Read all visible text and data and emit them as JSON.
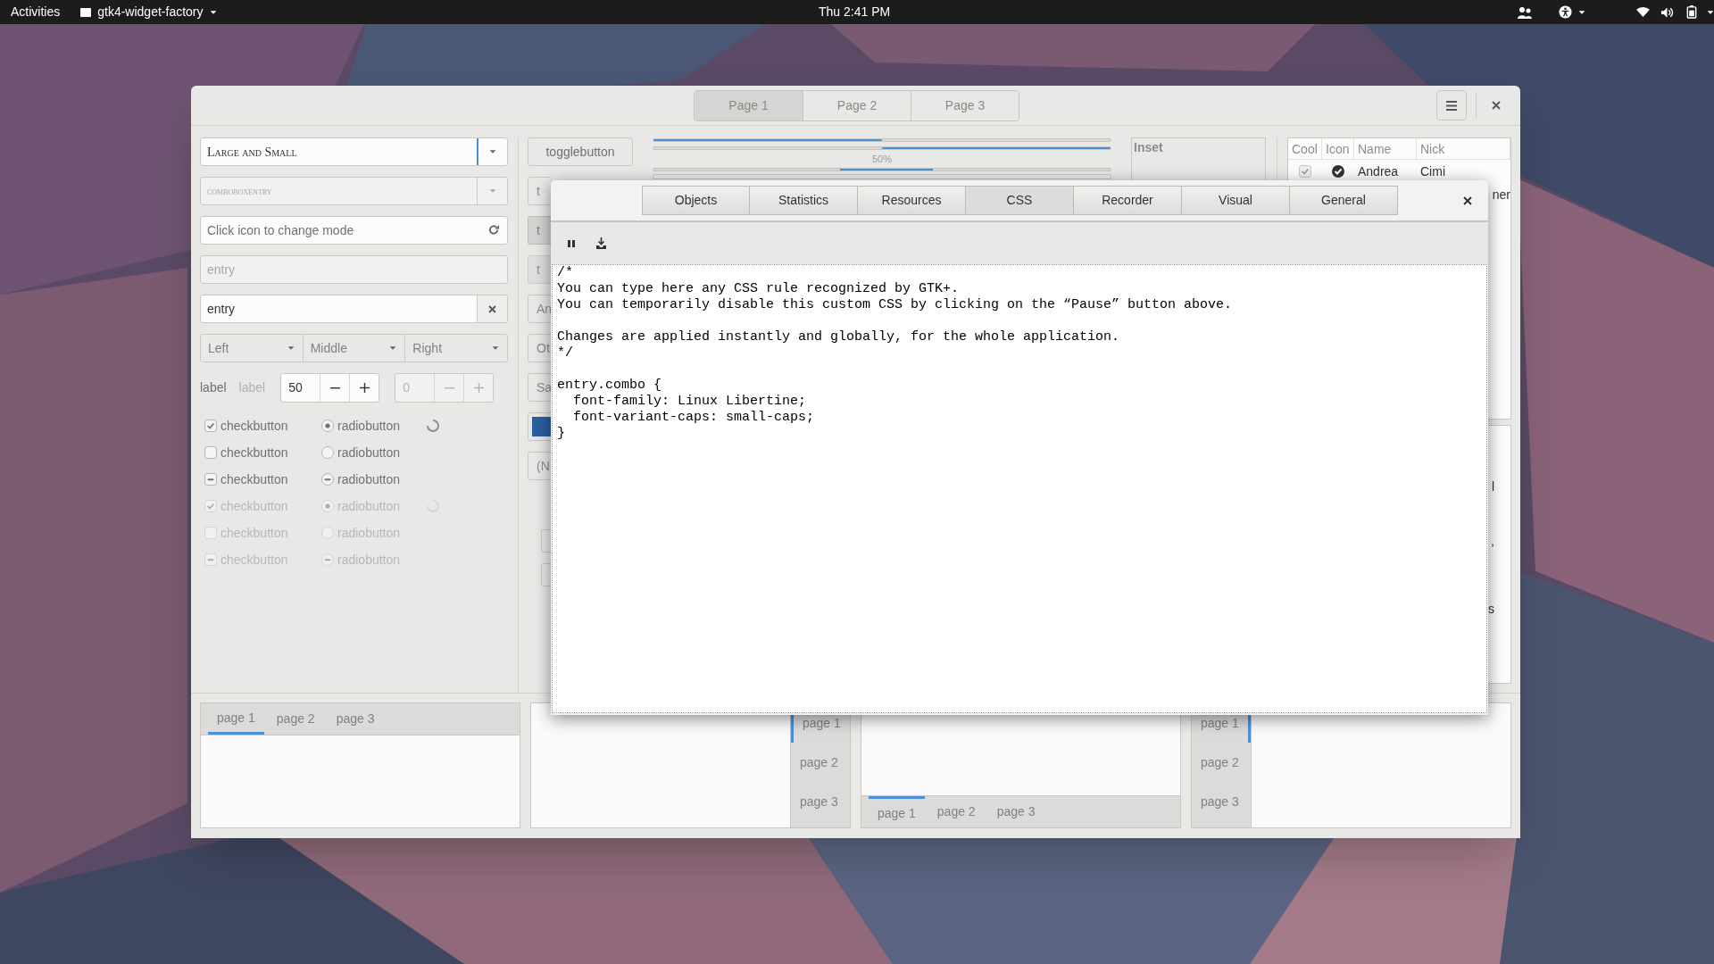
{
  "top_bar": {
    "activities": "Activities",
    "app_menu": "gtk4-widget-factory",
    "clock": "Thu  2:41 PM"
  },
  "main_window": {
    "stack_switcher": [
      {
        "label": "Page 1",
        "selected": true
      },
      {
        "label": "Page 2",
        "selected": false
      },
      {
        "label": "Page 3",
        "selected": false
      }
    ],
    "combo": {
      "value": "Large and Small"
    },
    "combo_entry": {
      "value": "comboboxentry",
      "disabled": true
    },
    "mode_entry": {
      "placeholder": "Click icon to change mode"
    },
    "disabled_entry": {
      "value": "entry",
      "disabled": true
    },
    "clear_entry": {
      "value": "entry"
    },
    "linked_combos": [
      {
        "label": "Left"
      },
      {
        "label": "Middle"
      },
      {
        "label": "Right"
      }
    ],
    "labels": [
      {
        "text": "label",
        "disabled": false
      },
      {
        "text": "label",
        "disabled": true
      }
    ],
    "spin_buttons": [
      {
        "value": "50",
        "disabled": false
      },
      {
        "value": "0",
        "disabled": true
      }
    ],
    "check_rows": [
      {
        "kind": "checked",
        "check_label": "checkbutton",
        "radio_label": "radiobutton",
        "spinner": true,
        "disabled": false
      },
      {
        "kind": "unchecked",
        "check_label": "checkbutton",
        "radio_label": "radiobutton",
        "spinner": false,
        "disabled": false
      },
      {
        "kind": "mixed",
        "check_label": "checkbutton",
        "radio_label": "radiobutton",
        "spinner": false,
        "disabled": false
      },
      {
        "kind": "checked",
        "check_label": "checkbutton",
        "radio_label": "radiobutton",
        "spinner": true,
        "disabled": true
      },
      {
        "kind": "unchecked",
        "check_label": "checkbutton",
        "radio_label": "radiobutton",
        "spinner": false,
        "disabled": true
      },
      {
        "kind": "mixed",
        "check_label": "checkbutton",
        "radio_label": "radiobutton",
        "spinner": false,
        "disabled": true
      }
    ],
    "buttons": [
      {
        "kind": "normal",
        "label": "togglebutton"
      },
      {
        "kind": "stub",
        "label": "t"
      },
      {
        "kind": "pressed",
        "label": "t"
      },
      {
        "kind": "pressed-disabled",
        "label": "t"
      },
      {
        "kind": "stub",
        "label": "An"
      },
      {
        "kind": "stub",
        "label": "Ot"
      },
      {
        "kind": "stub",
        "label": "Sa"
      },
      {
        "kind": "color",
        "color": "#2a5f9e"
      },
      {
        "kind": "stub",
        "label": "(N"
      },
      {
        "kind": "blank"
      },
      {
        "kind": "blank"
      }
    ],
    "progress": {
      "bars": [
        {
          "kind": "normal",
          "level": 0.5
        },
        {
          "kind": "inverted",
          "level": 0.5
        }
      ],
      "label": "50%"
    },
    "inset_frame": {
      "label": "Inset"
    },
    "tree": {
      "columns": [
        "Cool",
        "Icon",
        "Name",
        "Nick"
      ],
      "rows": [
        {
          "cool": true,
          "name": "Andrea",
          "nick": "Cimi"
        },
        {
          "nick": "ner"
        }
      ]
    },
    "side_panel_fragments": [
      "l",
      ",",
      "s"
    ],
    "notebooks": [
      {
        "kind": "top",
        "tabs": [
          {
            "label": "page 1",
            "selected": true
          },
          {
            "label": "page 2",
            "selected": false
          },
          {
            "label": "page 3",
            "selected": false
          }
        ]
      },
      {
        "kind": "right",
        "tabs": [
          {
            "label": "page 1",
            "selected": true
          },
          {
            "label": "page 2",
            "selected": false
          },
          {
            "label": "page 3",
            "selected": false
          }
        ]
      },
      {
        "kind": "bottom",
        "tabs": [
          {
            "label": "page 1",
            "selected": true
          },
          {
            "label": "page 2",
            "selected": false
          },
          {
            "label": "page 3",
            "selected": false
          }
        ]
      },
      {
        "kind": "left",
        "tabs": [
          {
            "label": "page 1",
            "selected": true
          },
          {
            "label": "page 2",
            "selected": false
          },
          {
            "label": "page 3",
            "selected": false
          }
        ]
      }
    ]
  },
  "inspector": {
    "tabs": [
      {
        "label": "Objects",
        "selected": false
      },
      {
        "label": "Statistics",
        "selected": false
      },
      {
        "label": "Resources",
        "selected": false
      },
      {
        "label": "CSS",
        "selected": true
      },
      {
        "label": "Recorder",
        "selected": false
      },
      {
        "label": "Visual",
        "selected": false
      },
      {
        "label": "General",
        "selected": false
      }
    ],
    "css_text": "/*\nYou can type here any CSS rule recognized by GTK+.\nYou can temporarily disable this custom CSS by clicking on the “Pause” button above.\n\nChanges are applied instantly and globally, for the whole application.\n*/\n\nentry.combo {\n  font-family: Linux Libertine;\n  font-variant-caps: small-caps;\n}"
  }
}
